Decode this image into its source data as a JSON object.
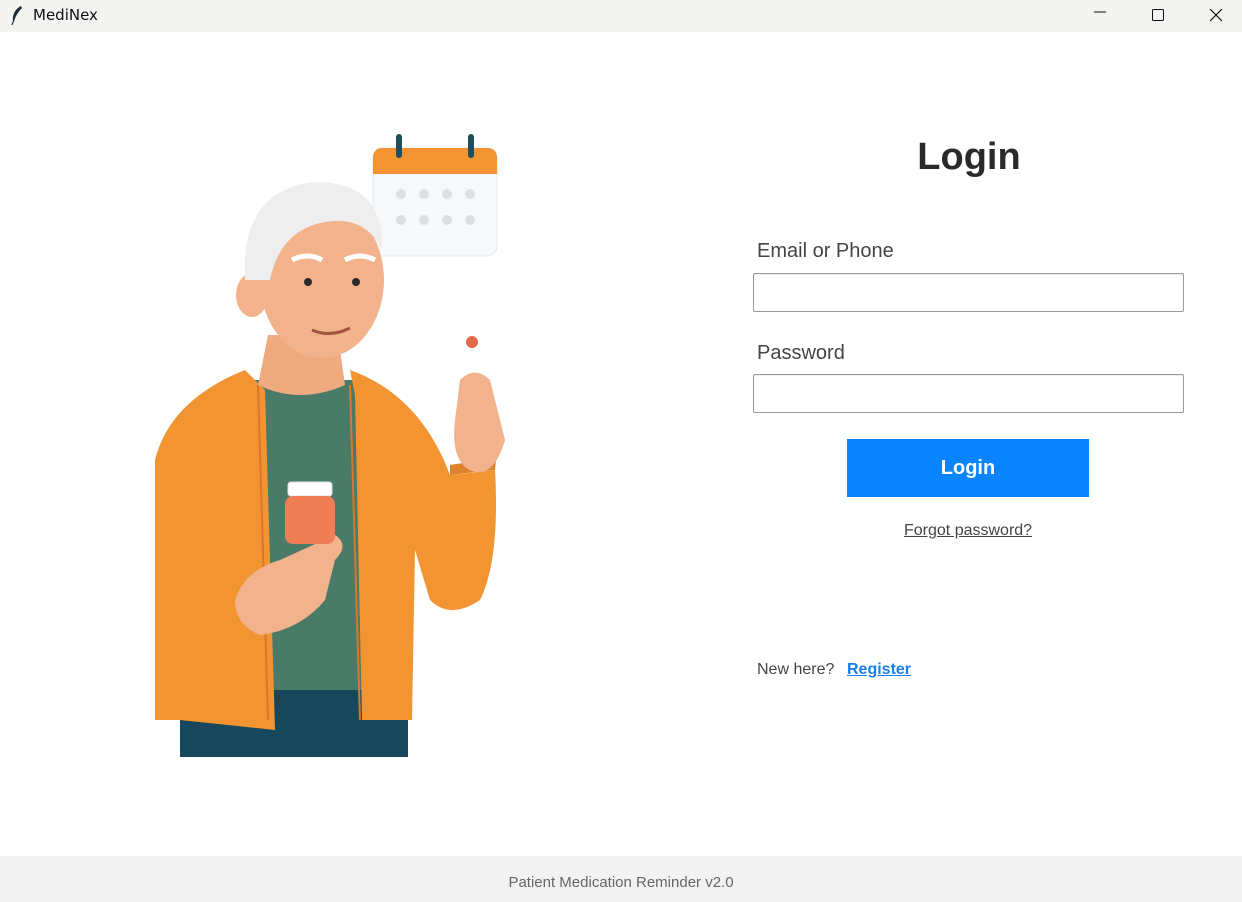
{
  "window": {
    "title": "MediNex",
    "icon": "feather-icon",
    "controls": [
      "minimize-icon",
      "maximize-icon",
      "close-icon"
    ]
  },
  "illustration": {
    "description_icon": "elderly-man-with-pills-and-calendar-illustration"
  },
  "login": {
    "title": "Login",
    "email_label": "Email or Phone",
    "email_value": "",
    "password_label": "Password",
    "password_value": "",
    "button_label": "Login",
    "forgot_label": "Forgot password?",
    "new_here_text": "New here?",
    "register_label": "Register"
  },
  "footer": {
    "text": "Patient Medication Reminder v2.0"
  },
  "colors": {
    "primary_button": "#0a84ff",
    "link": "#1a7fe8",
    "jacket_orange": "#f39433",
    "shirt_green": "#4a7a68",
    "pants_teal": "#17475a"
  }
}
